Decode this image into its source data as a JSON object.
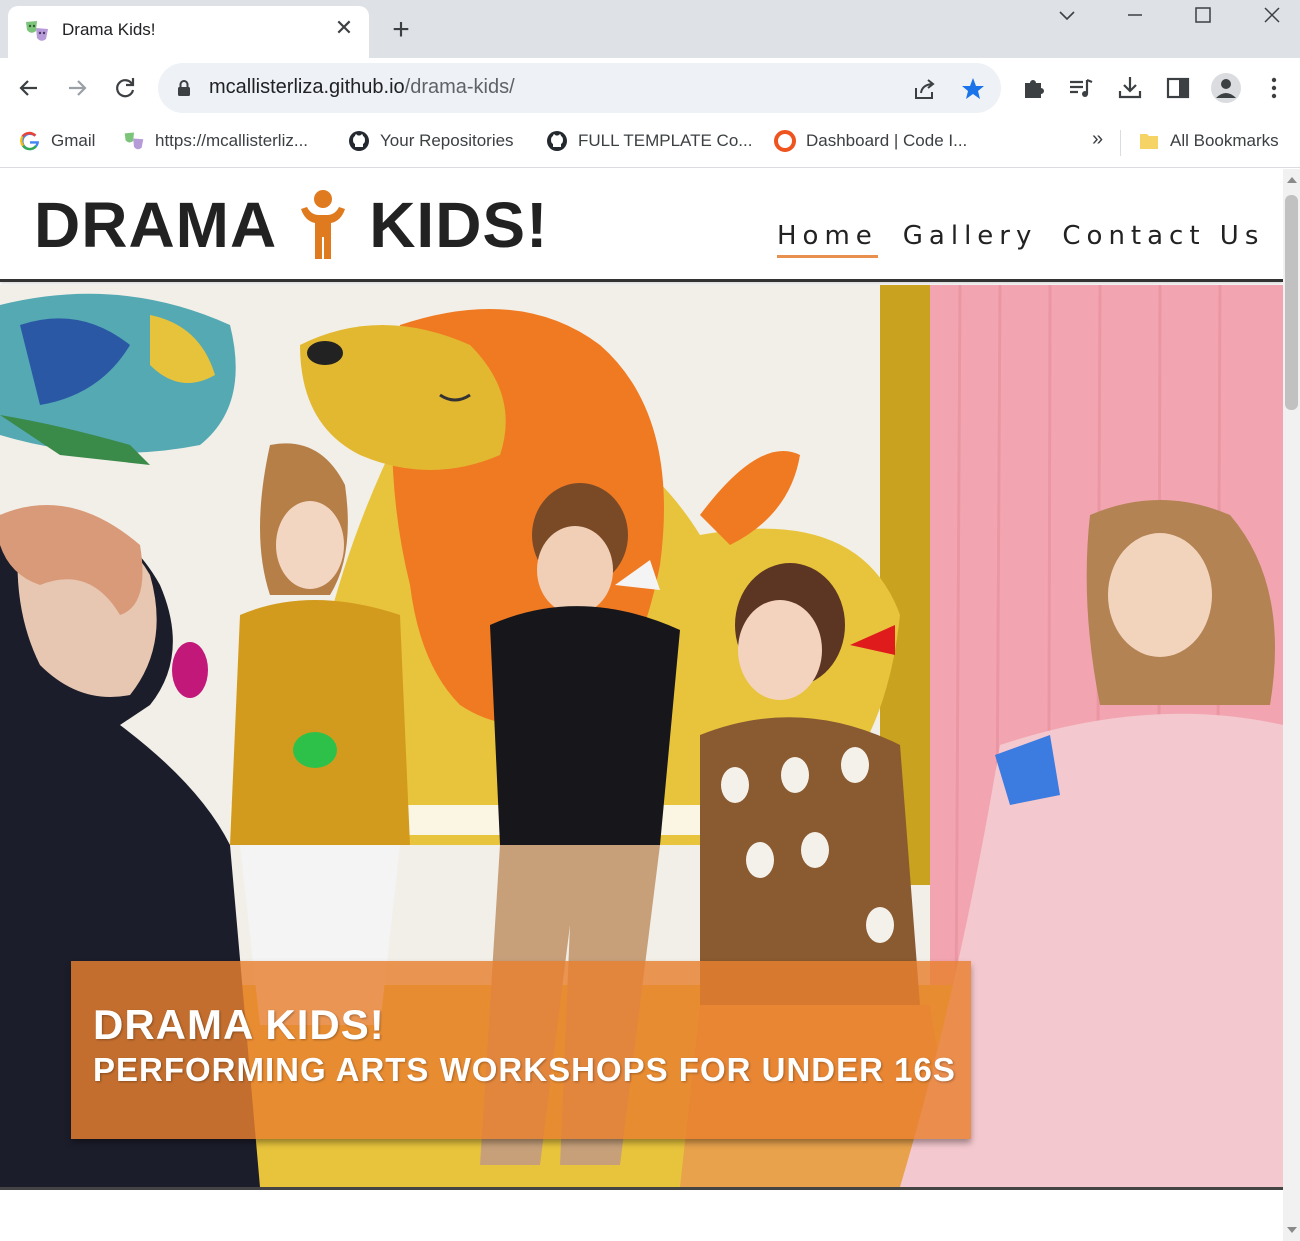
{
  "browser": {
    "tab_title": "Drama Kids!",
    "url_host": "mcallisterliza.github.io",
    "url_path": "/drama-kids/",
    "bookmarks": [
      {
        "label": "Gmail",
        "icon": "google-icon"
      },
      {
        "label": "https://mcallisterliz...",
        "icon": "drama-masks-icon"
      },
      {
        "label": "Your Repositories",
        "icon": "github-icon"
      },
      {
        "label": "FULL TEMPLATE Co...",
        "icon": "github-icon"
      },
      {
        "label": "Dashboard | Code I...",
        "icon": "code-institute-icon"
      }
    ],
    "bookmarks_overflow": "»",
    "all_bookmarks": "All Bookmarks"
  },
  "site": {
    "logo_left": "DRAMA",
    "logo_right": "KIDS!",
    "nav": [
      {
        "label": "Home",
        "active": true
      },
      {
        "label": "Gallery",
        "active": false
      },
      {
        "label": "Contact Us",
        "active": false
      }
    ],
    "hero": {
      "title": "DRAMA KIDS!",
      "subtitle": "PERFORMING ARTS WORKSHOPS FOR UNDER 16S"
    }
  },
  "colors": {
    "accent": "#e8914f",
    "logo_figure": "#e07a1f",
    "caption_bg": "#e88030",
    "star": "#1a73e8"
  }
}
